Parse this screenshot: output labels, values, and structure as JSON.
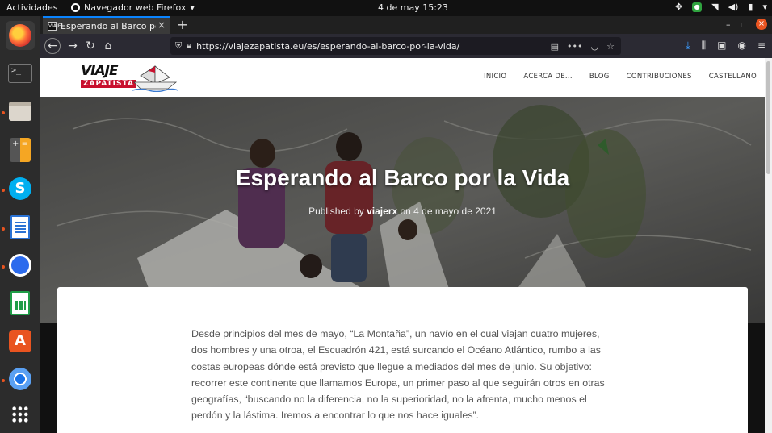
{
  "topbar": {
    "activities": "Actividades",
    "app_name": "Navegador web Firefox",
    "app_caret": "▾",
    "clock": "4 de may  15:23"
  },
  "dock": {
    "items": [
      "firefox-icon",
      "terminal-icon",
      "files-icon",
      "calculator-icon",
      "skype-icon",
      "writer-icon",
      "signal-icon",
      "calc-spreadsheet-icon",
      "software-store-icon",
      "chromium-icon",
      "app-grid-icon"
    ]
  },
  "browser": {
    "tab_title": "Esperando al Barco por la Vida",
    "tab_favicon": "VIAJE",
    "new_tab": "+",
    "url": "https://viajezapatista.eu/es/esperando-al-barco-por-la-vida/",
    "accent_color": "#0a84ff"
  },
  "site": {
    "logo_word1": "VIAJE",
    "logo_word2": "ZAPATISTA",
    "menu": [
      "INICIO",
      "ACERCA DE...",
      "BLOG",
      "CONTRIBUCIONES",
      "CASTELLANO"
    ]
  },
  "hero": {
    "title": "Esperando al Barco por la Vida",
    "meta_prefix": "Published by ",
    "author": "viajerx",
    "meta_suffix": " on 4 de mayo de 2021"
  },
  "article": {
    "paragraph": "Desde principios del mes de mayo, “La Montaña”, un navío en el cual viajan cuatro mujeres, dos hombres y una otroa, el Escuadrón 421, está surcando el Océano Atlántico, rumbo a las costas europeas dónde está previsto que llegue a mediados del mes de junio. Su objetivo: recorrer este continente que llamamos Europa, un primer paso al que seguirán otros en otras geografías, “buscando no la diferencia, no la superioridad, no la afrenta, mucho menos el perdón y la lástima. Iremos a encontrar lo que nos hace iguales”."
  }
}
